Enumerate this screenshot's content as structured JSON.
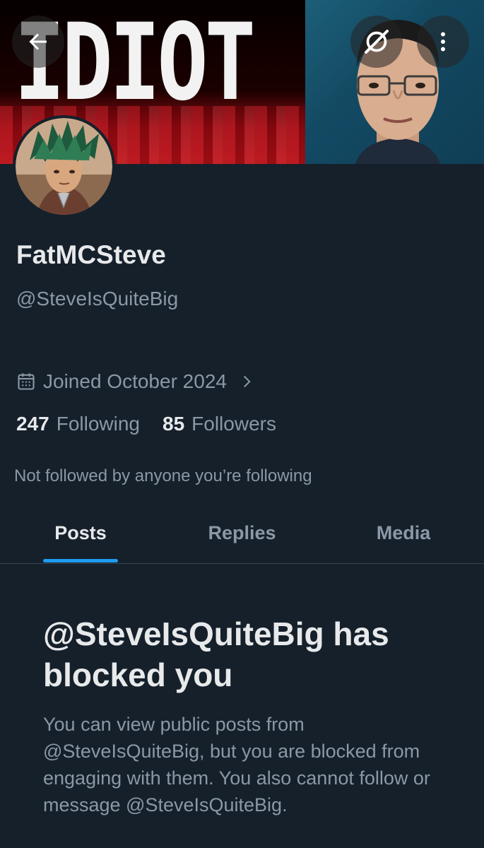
{
  "profile": {
    "display_name": "FatMCSteve",
    "handle": "@SteveIsQuiteBig",
    "joined": "Joined October 2024",
    "following_count": "247",
    "following_label": "Following",
    "followers_count": "85",
    "followers_label": "Followers",
    "not_followed_text": "Not followed by anyone you’re following"
  },
  "banner": {
    "text": "IDIOT"
  },
  "tabs": [
    {
      "label": "Posts",
      "active": true
    },
    {
      "label": "Replies",
      "active": false
    },
    {
      "label": "Media",
      "active": false
    }
  ],
  "blocked": {
    "title": "@SteveIsQuiteBig has blocked you",
    "body": "You can view public posts from @SteveIsQuiteBig, but you are blocked from engaging with them. You also cannot follow or message @SteveIsQuiteBig."
  },
  "icons": {
    "back": "back-arrow-icon",
    "grok": "grok-icon",
    "more": "more-vertical-icon",
    "calendar": "calendar-icon",
    "chevron": "chevron-right-icon"
  },
  "colors": {
    "background": "#15202b",
    "accent": "#1d9bf0",
    "text_primary": "#e7e9ea",
    "text_secondary": "#8b98a5",
    "divider": "#38444d"
  }
}
